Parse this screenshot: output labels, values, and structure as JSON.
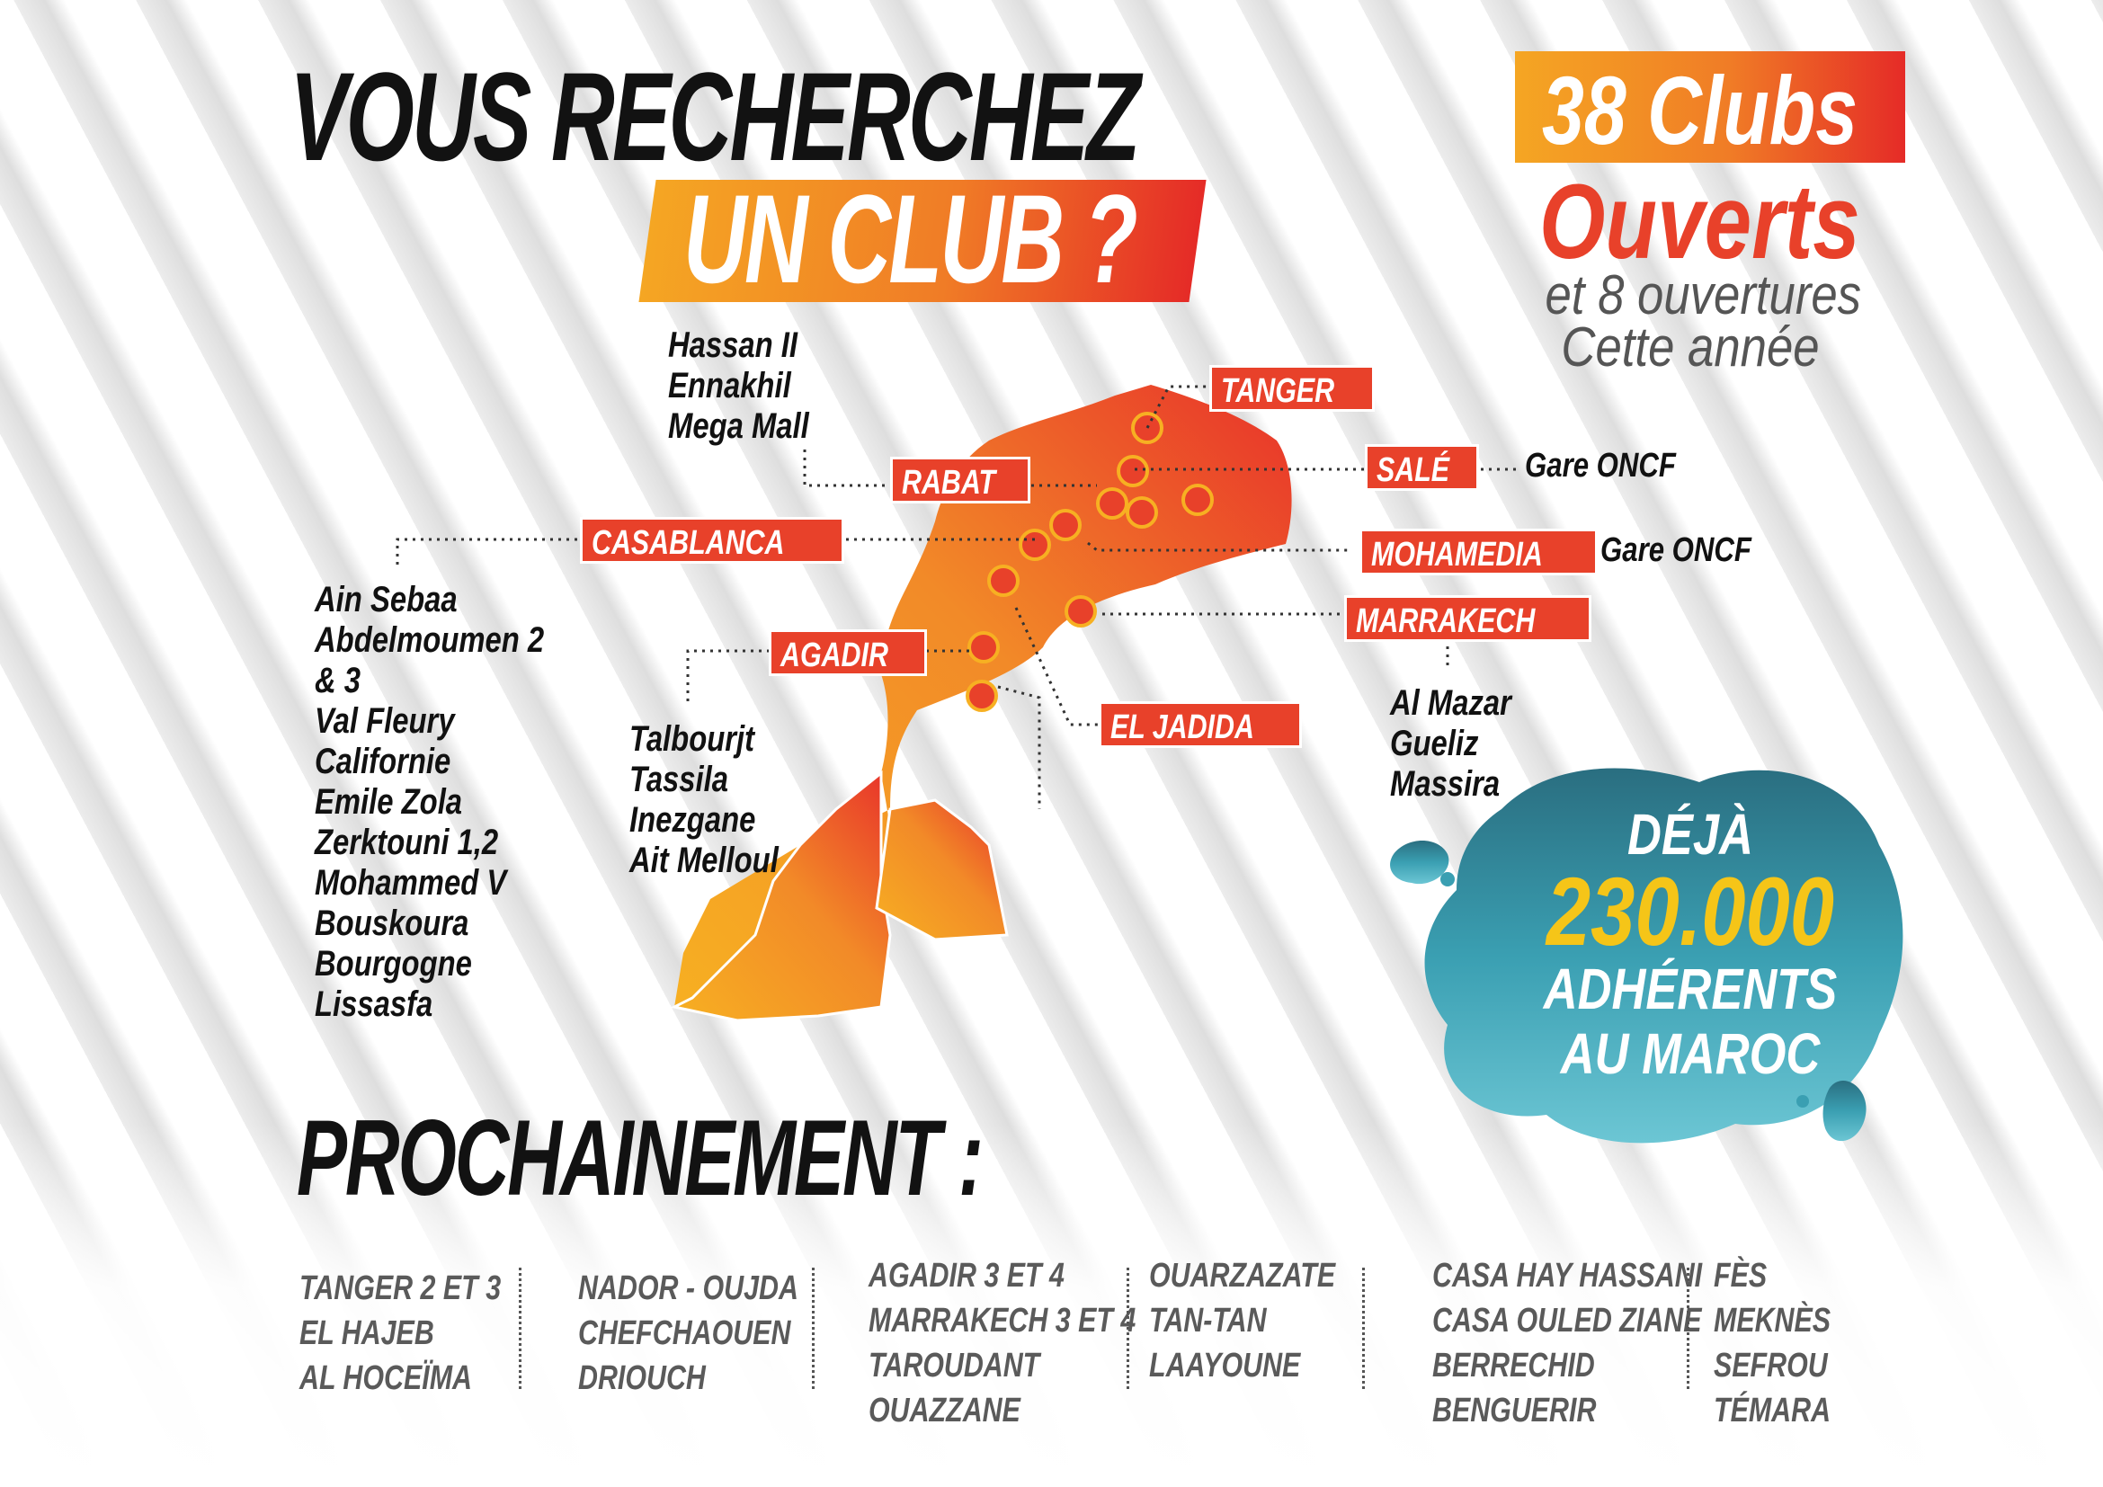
{
  "heading": {
    "line1": "VOUS RECHERCHEZ",
    "line2": "UN CLUB ?"
  },
  "stats": {
    "clubs_count": "38 Clubs",
    "clubs_status": "Ouverts",
    "openings_line1": "et 8 ouvertures",
    "openings_line2": "Cette année"
  },
  "members": {
    "prefix": "DÉJÀ",
    "count": "230.000",
    "line1": "ADHÉRENTS",
    "line2": "AU MAROC"
  },
  "cities": {
    "tanger": "TANGER",
    "sale": "SALÉ",
    "rabat": "RABAT",
    "casablanca": "CASABLANCA",
    "mohamedia": "MOHAMEDIA",
    "marrakech": "MARRAKECH",
    "agadir": "AGADIR",
    "el_jadida": "EL JADIDA"
  },
  "clubs": {
    "rabat": [
      "Hassan II",
      "Ennakhil",
      "Mega Mall"
    ],
    "casablanca": [
      "Ain Sebaa",
      "Abdelmoumen 2",
      "& 3",
      "Val Fleury",
      "Californie",
      "Emile Zola",
      "Zerktouni 1,2",
      "Mohammed V",
      "Bouskoura",
      "Bourgogne",
      "Lissasfa"
    ],
    "agadir": [
      "Talbourjt",
      "Tassila",
      "Inezgane",
      "Ait Melloul"
    ],
    "marrakech": [
      "Al Mazar",
      "Gueliz",
      "Massira"
    ],
    "sale": "Gare ONCF",
    "mohamedia": "Gare ONCF"
  },
  "upcoming": {
    "title": "PROCHAINEMENT :",
    "columns": [
      [
        "TANGER 2 ET 3",
        "EL HAJEB",
        "AL HOCEÏMA"
      ],
      [
        "NADOR - OUJDA",
        "CHEFCHAOUEN",
        "DRIOUCH"
      ],
      [
        "AGADIR 3 ET 4",
        "MARRAKECH 3 ET 4",
        "TAROUDANT",
        "OUAZZANE"
      ],
      [
        "OUARZAZATE",
        "TAN-TAN",
        "LAAYOUNE"
      ],
      [
        "CASA HAY HASSANI",
        "CASA OULED ZIANE",
        "BERRECHID",
        "BENGUERIR"
      ],
      [
        "FÈS",
        "MEKNÈS",
        "SEFROU",
        "TÉMARA"
      ]
    ]
  },
  "colors": {
    "accent_red": "#e8412a",
    "accent_orange": "#f5a623",
    "blob_teal": "#2e8fa3",
    "highlight_yellow": "#f5c518"
  }
}
